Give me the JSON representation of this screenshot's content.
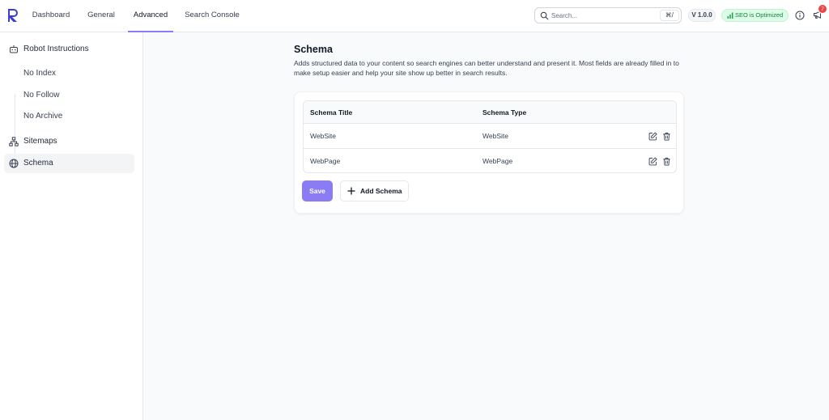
{
  "colors": {
    "accent": "#8b7cf6",
    "success": "#15803d",
    "danger": "#ef4444",
    "logo": "#3b3bd6"
  },
  "nav": {
    "tabs": [
      {
        "label": "Dashboard"
      },
      {
        "label": "General"
      },
      {
        "label": "Advanced",
        "active": true
      },
      {
        "label": "Search Console"
      }
    ]
  },
  "header": {
    "search_placeholder": "Search...",
    "search_shortcut": "⌘/",
    "version": "V 1.0.0",
    "seo_status": "SEO is Optimized",
    "notification_count": "7",
    "icons": [
      "logo",
      "search-icon",
      "signal-icon",
      "info-icon",
      "megaphone-icon"
    ]
  },
  "sidebar": {
    "robot": {
      "label": "Robot Instructions",
      "icon": "robot-icon"
    },
    "sub_items": [
      {
        "label": "No Index"
      },
      {
        "label": "No Follow"
      },
      {
        "label": "No Archive"
      }
    ],
    "sitemaps": {
      "label": "Sitemaps",
      "icon": "sitemap-icon"
    },
    "schema": {
      "label": "Schema",
      "icon": "globe-icon",
      "active": true
    }
  },
  "main": {
    "title": "Schema",
    "description": "Adds structured data to your content so search engines can better understand and present it. Most fields are already filled in to make setup easier and help your site show up better in search results.",
    "table": {
      "columns": [
        "Schema Title",
        "Schema Type"
      ],
      "rows": [
        {
          "title": "WebSite",
          "type": "WebSite"
        },
        {
          "title": "WebPage",
          "type": "WebPage"
        }
      ]
    },
    "save_label": "Save",
    "add_label": "Add Schema"
  }
}
